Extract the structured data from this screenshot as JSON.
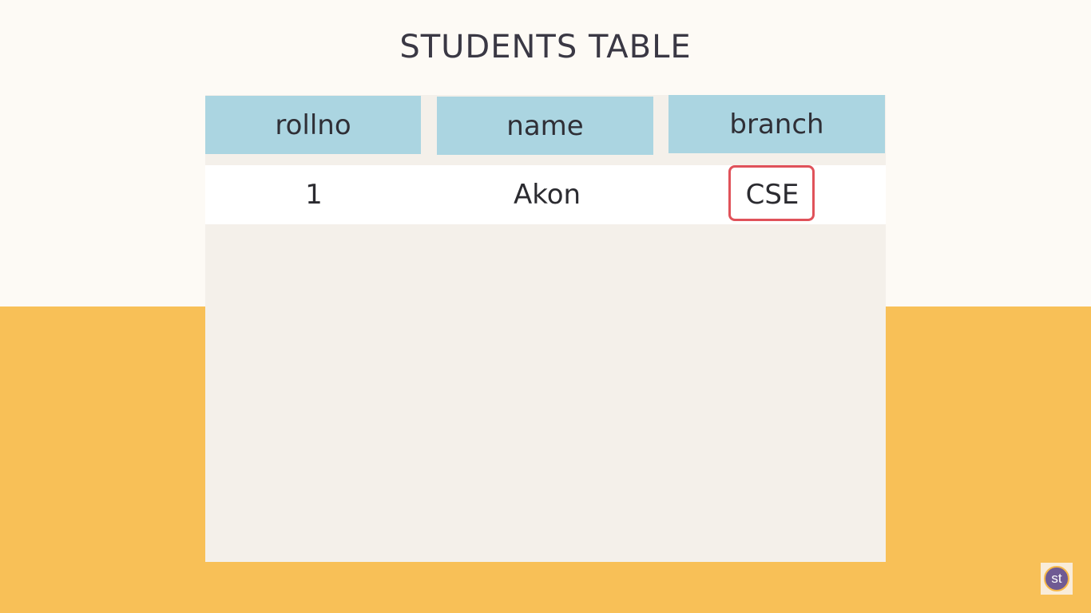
{
  "title": "STUDENTS TABLE",
  "table": {
    "headers": [
      "rollno",
      "name",
      "branch"
    ],
    "rows": [
      [
        "1",
        "Akon",
        "CSE"
      ]
    ],
    "highlighted_cell": "CSE"
  },
  "logo": {
    "text": "st",
    "icon": "studytonight-logo-icon"
  },
  "colors": {
    "header_bg": "#abd5e1",
    "highlight_border": "#e0525a",
    "bottom_bg": "#f8c057"
  }
}
